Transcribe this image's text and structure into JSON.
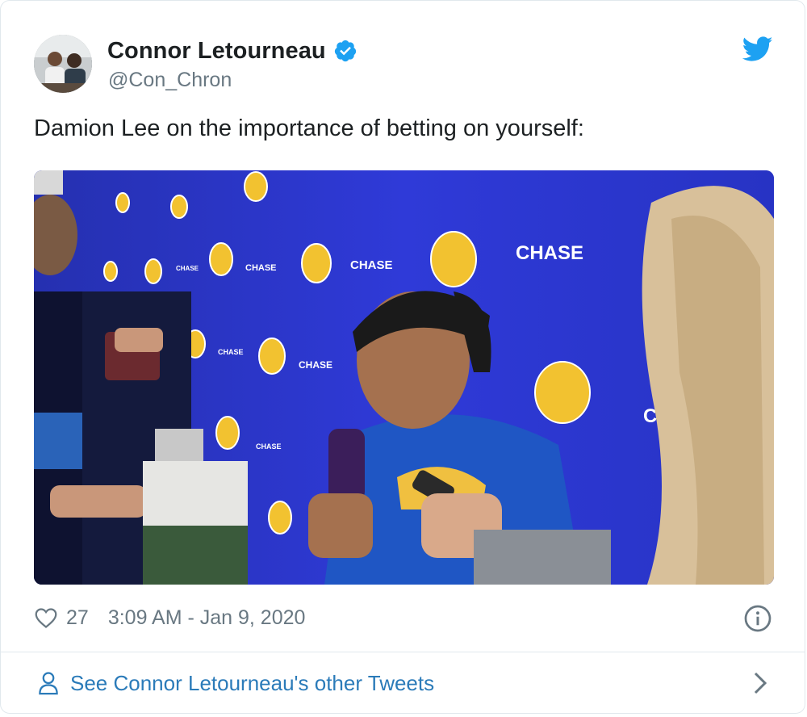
{
  "author": {
    "display_name": "Connor Letourneau",
    "handle": "@Con_Chron",
    "verified": true
  },
  "tweet": {
    "text": "Damion Lee on the importance of betting on yourself:",
    "like_count": "27",
    "timestamp": "3:09 AM - Jan 9, 2020"
  },
  "media": {
    "type": "video-thumbnail",
    "backdrop_texts": [
      "CHASE",
      "CHASE",
      "CHASE",
      "CHASE",
      "CHASE",
      "CHASE",
      "CHASE"
    ]
  },
  "footer": {
    "other_tweets_link": "See Connor Letourneau's other Tweets"
  },
  "icons": {
    "verified": "verified-badge-icon",
    "brand": "twitter-bird-icon",
    "like": "heart-icon",
    "info": "info-icon",
    "profile": "person-icon",
    "chevron": "chevron-right-icon"
  },
  "colors": {
    "twitter_blue": "#1da1f2",
    "link_blue": "#2b7bb9",
    "meta_gray": "#697882",
    "text_dark": "#1c2022",
    "border": "#e1e8ed",
    "backdrop_blue": "#2a34c8"
  }
}
